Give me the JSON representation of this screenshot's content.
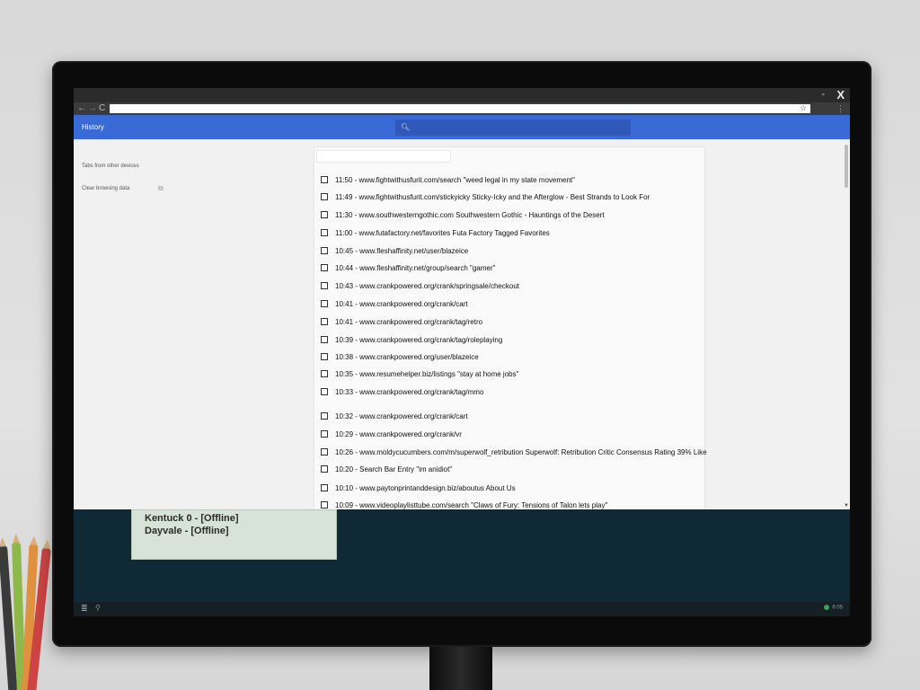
{
  "window": {
    "minimize_glyph": "-",
    "close_glyph": "X"
  },
  "toolbar": {
    "back_glyph": "←",
    "forward_glyph": "→",
    "reload_glyph": "C",
    "star_glyph": "☆",
    "menu_glyph": "⋮",
    "address": ""
  },
  "appbar": {
    "title": "History",
    "search_placeholder": ""
  },
  "sidebar": {
    "tabs_from_other_devices": "Tabs from other devices",
    "clear_browsing_data": "Clear browsing data"
  },
  "history": {
    "items": [
      {
        "text": "11:50 - www.fightwithusfurit.com/search \"weed legal in my state movement\""
      },
      {
        "text": "11:49 - www.fightwithusfurit.com/stickyicky Sticky-Icky and the Afterglow - Best Strands to Look For"
      },
      {
        "text": "11:30 - www.southwesterngothic.com Southwestern Gothic - Hauntings of the Desert"
      },
      {
        "text": "11:00 - www.futafactory.net/favorites Futa Factory Tagged Favorites"
      },
      {
        "text": "10:45 - www.fleshaffinity.net/user/blazeice"
      },
      {
        "text": "10:44 - www.fleshaffinity.net/group/search \"gamer\""
      },
      {
        "text": "10:43 - www.crankpowered.org/crank/springsale/checkout"
      },
      {
        "text": "10:41 - www.crankpowered.org/crank/cart"
      },
      {
        "text": "10:41 - www.crankpowered.org/crank/tag/retro"
      },
      {
        "text": "10:39 - www.crankpowered.org/crank/tag/roleplaying"
      },
      {
        "text": "10:38 - www.crankpowered.org/user/blazeice"
      },
      {
        "text": "10:35 - www.resumehelper.biz/listings \"stay at home jobs\""
      },
      {
        "text": "10:33 - www.crankpowered.org/crank/tag/mmo"
      },
      {
        "text": "10:32 - www.crankpowered.org/crank/cart"
      },
      {
        "text": "10:29 - www.crankpowered.org/crank/vr"
      },
      {
        "text": "10:26 - www.moldycucumbers.com/m/superwolf_retribution Superwolf: Retribution Critic Consensus Rating 39% Like"
      },
      {
        "text": "10:20 - Search Bar Entry \"im anidiot\""
      },
      {
        "text": "10:10 - www.paytonprintanddesign.biz/aboutus About Us"
      },
      {
        "text": "10:09 - www.videoplaylisttube.com/search \"Claws of Fury: Tensions of Talon lets play\""
      }
    ]
  },
  "widget": {
    "lines": [
      "Kentuck 0 - [Offline]",
      "Dayvale - [Offline]"
    ]
  },
  "taskbar": {
    "start_glyph": "≣",
    "tray_glyph": "⚲",
    "clock": "6:05"
  },
  "colors": {
    "appbar": "#3a6ad6",
    "appbar_search": "#2f58b8",
    "desktop": "#0f2a36",
    "widget": "#d7e3d6"
  }
}
